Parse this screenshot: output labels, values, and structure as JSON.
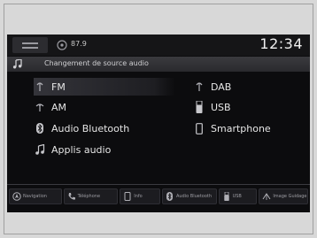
{
  "status_bar": {
    "station": "87.9",
    "clock": "12:34"
  },
  "title_bar": {
    "title": "Changement de source audio"
  },
  "sources": [
    {
      "label": "FM",
      "icon": "radio-icon",
      "selected": true
    },
    {
      "label": "DAB",
      "icon": "radio-icon",
      "selected": false
    },
    {
      "label": "AM",
      "icon": "radio-icon",
      "selected": false
    },
    {
      "label": "USB",
      "icon": "usb-icon",
      "selected": false
    },
    {
      "label": "Audio Bluetooth",
      "icon": "bluetooth-icon",
      "selected": false
    },
    {
      "label": "Smartphone",
      "icon": "smartphone-icon",
      "selected": false
    },
    {
      "label": "Applis audio",
      "icon": "music-note-icon",
      "selected": false
    }
  ],
  "shortcuts": [
    {
      "label": "Navigation",
      "icon": "navigation-icon"
    },
    {
      "label": "Téléphone",
      "icon": "phone-icon"
    },
    {
      "label": "Info",
      "icon": "info-icon"
    },
    {
      "label": "Audio Bluetooth",
      "icon": "bluetooth-icon"
    },
    {
      "label": "USB",
      "icon": "usb-icon"
    },
    {
      "label": "Image Guidage",
      "icon": "guide-icon"
    }
  ],
  "colors": {
    "screen_background": "#0c0c0e",
    "title_bar": "#323236",
    "text": "#e6e6e6"
  }
}
